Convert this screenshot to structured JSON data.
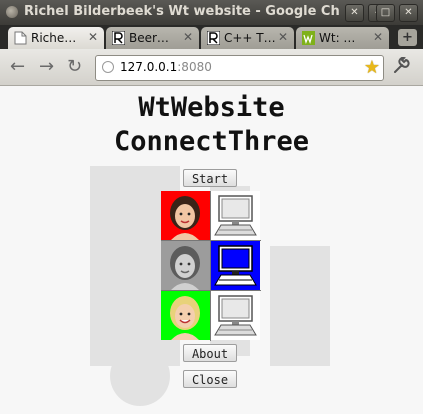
{
  "window": {
    "title": "Richel Bilderbeek's Wt website - Google Ch",
    "controls": [
      "✕",
      "–",
      "□",
      "✕"
    ]
  },
  "tabs": [
    {
      "label": "Riche…",
      "close": "✕",
      "active": true,
      "icon": "page-icon"
    },
    {
      "label": "Beer…",
      "close": "✕",
      "active": false,
      "icon": "rb-logo-icon"
    },
    {
      "label": "C++ T…",
      "close": "✕",
      "active": false,
      "icon": "rb-logo-icon"
    },
    {
      "label": "Wt: …",
      "close": "✕",
      "active": false,
      "icon": "wt-logo-icon"
    }
  ],
  "new_tab_label": "+",
  "toolbar": {
    "back": "←",
    "forward": "→",
    "reload": "↻",
    "url_host": "127.0.0.1",
    "url_port": ":8080",
    "star": "★",
    "wrench": "🔧"
  },
  "page": {
    "title_line1": "WtWebsite",
    "title_line2": "ConnectThree",
    "start_label": "Start",
    "about_label": "About",
    "close_label": "Close"
  },
  "board": {
    "rows": [
      [
        {
          "type": "player",
          "bg": "#ff0000"
        },
        {
          "type": "computer",
          "bg": "#ffffff",
          "screen": "#ffffff"
        }
      ],
      [
        {
          "type": "player",
          "bg": "#9c9c9c"
        },
        {
          "type": "computer",
          "bg": "#0000ff",
          "screen": "#0000ff"
        }
      ],
      [
        {
          "type": "player",
          "bg": "#00ff00"
        },
        {
          "type": "computer",
          "bg": "#ffffff",
          "screen": "#ffffff"
        }
      ]
    ]
  },
  "colors": {
    "player1": "#ff0000",
    "player2": "#9c9c9c",
    "player3": "#00ff00",
    "computer_active": "#0000ff"
  }
}
